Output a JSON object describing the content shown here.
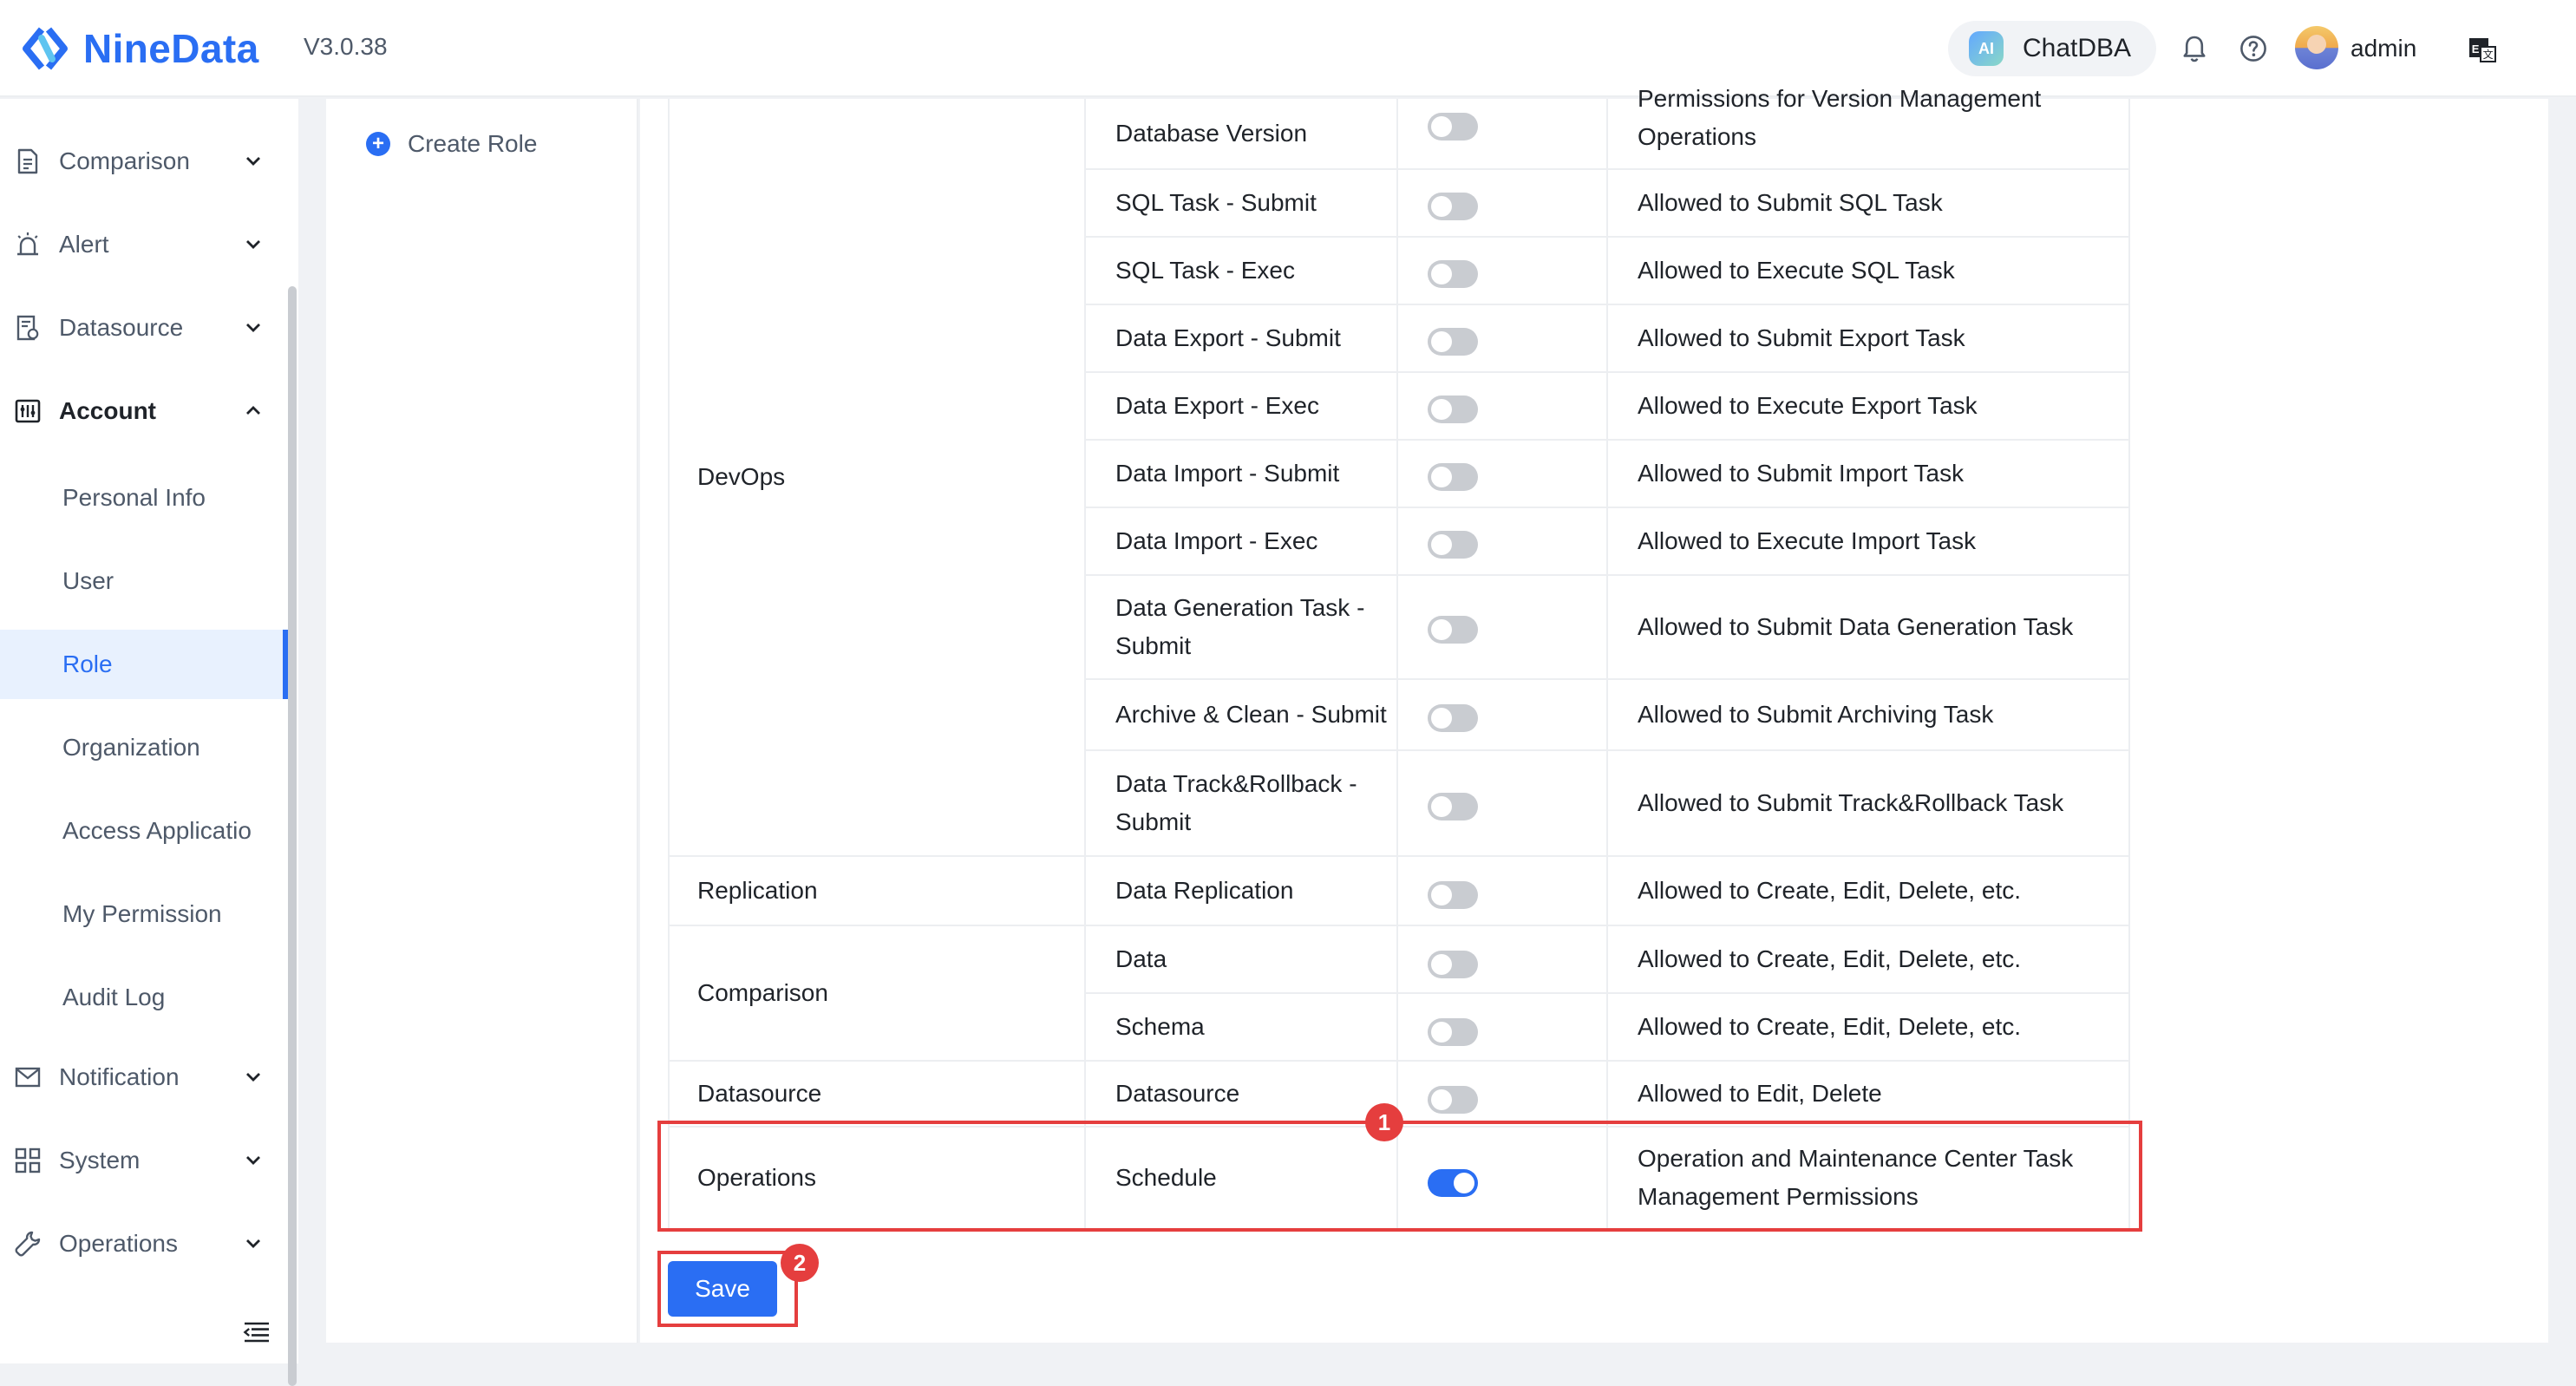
{
  "header": {
    "brand": "NineData",
    "version": "V3.0.38",
    "chatdba_label": "ChatDBA",
    "chatdba_icon_text": "AI",
    "user": "admin"
  },
  "sidebar": {
    "items": [
      {
        "label": "Comparison",
        "icon": "file-compare-icon"
      },
      {
        "label": "Alert",
        "icon": "alarm-icon"
      },
      {
        "label": "Datasource",
        "icon": "datasource-icon"
      },
      {
        "label": "Account",
        "icon": "account-icon",
        "expanded": true
      },
      {
        "label": "Notification",
        "icon": "mail-icon"
      },
      {
        "label": "System",
        "icon": "grid-icon"
      },
      {
        "label": "Operations",
        "icon": "wrench-icon"
      }
    ],
    "account_sub": [
      "Personal Info",
      "User",
      "Role",
      "Organization",
      "Access Applicatio",
      "My Permission",
      "Audit Log"
    ],
    "active_sub": "Role"
  },
  "role_panel": {
    "create_label": "Create Role"
  },
  "permissions": {
    "groups": [
      {
        "name": "DevOps",
        "rows": [
          {
            "permission": "Database Version",
            "enabled": false,
            "description": "Permissions for Version Management Operations"
          },
          {
            "permission": "SQL Task - Submit",
            "enabled": false,
            "description": "Allowed to Submit SQL Task"
          },
          {
            "permission": "SQL Task - Exec",
            "enabled": false,
            "description": "Allowed to Execute SQL Task"
          },
          {
            "permission": "Data Export - Submit",
            "enabled": false,
            "description": "Allowed to Submit Export Task"
          },
          {
            "permission": "Data Export - Exec",
            "enabled": false,
            "description": "Allowed to Execute Export Task"
          },
          {
            "permission": "Data Import - Submit",
            "enabled": false,
            "description": "Allowed to Submit Import Task"
          },
          {
            "permission": "Data Import - Exec",
            "enabled": false,
            "description": "Allowed to Execute Import Task"
          },
          {
            "permission": "Data Generation Task - Submit",
            "enabled": false,
            "description": "Allowed to Submit Data Generation Task"
          },
          {
            "permission": "Archive & Clean - Submit",
            "enabled": false,
            "description": "Allowed to Submit Archiving Task"
          },
          {
            "permission": "Data Track&Rollback - Submit",
            "enabled": false,
            "description": "Allowed to Submit Track&Rollback Task"
          }
        ]
      },
      {
        "name": "Replication",
        "rows": [
          {
            "permission": "Data Replication",
            "enabled": false,
            "description": "Allowed to Create, Edit, Delete, etc."
          }
        ]
      },
      {
        "name": "Comparison",
        "rows": [
          {
            "permission": "Data",
            "enabled": false,
            "description": "Allowed to Create, Edit, Delete, etc."
          },
          {
            "permission": "Schema",
            "enabled": false,
            "description": "Allowed to Create, Edit, Delete, etc."
          }
        ]
      },
      {
        "name": "Datasource",
        "rows": [
          {
            "permission": "Datasource",
            "enabled": false,
            "description": "Allowed to Edit, Delete"
          }
        ]
      },
      {
        "name": "Operations",
        "rows": [
          {
            "permission": "Schedule",
            "enabled": true,
            "description": "Operation and Maintenance Center Task Management Permissions"
          }
        ]
      }
    ]
  },
  "annotations": {
    "badge_1": "1",
    "badge_2": "2"
  },
  "save_label": "Save",
  "colors": {
    "accent": "#2a6ef3",
    "highlight": "#e53e3e",
    "toggle_off": "#c9ccd1"
  }
}
